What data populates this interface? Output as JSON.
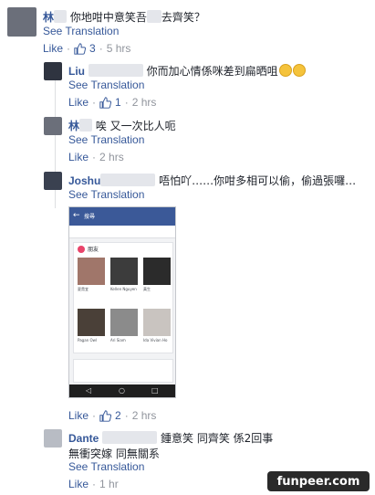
{
  "comments": [
    {
      "name": "林",
      "text_before": "你地咁中意笑吾",
      "text_after": "去齊笑？",
      "translation": "See Translation",
      "like": "Like",
      "likes": "3",
      "time": "5 hrs"
    },
    {
      "name": "Liu",
      "text": "你而加心情係咪差到扁晒咀",
      "translation": "See Translation",
      "like": "Like",
      "likes": "1",
      "time": "2 hrs"
    },
    {
      "name": "林",
      "text": "唉 又一次比人呃",
      "translation": "See Translation",
      "like": "Like",
      "time": "2 hrs"
    },
    {
      "name": "Joshu",
      "text": "唔怕吖……你咁多相可以偷，偷過張囉…",
      "translation": "See Translation",
      "like": "Like",
      "likes": "2",
      "time": "2 hrs"
    },
    {
      "name": "Dante",
      "text_line1": "鍾意笑 同齊笑 係2回事",
      "text_line2": "無衝突嫁 同無關系",
      "translation": "See Translation",
      "like": "Like",
      "time": "1 hr"
    }
  ],
  "screenshot": {
    "search_label": "搜尋",
    "section_title": "朋友",
    "friends": [
      "夏貴宜",
      "Kellen Nguyen",
      "黃生",
      "Pagan Owl",
      "Ari Siam",
      "Ida Vivian Ho"
    ]
  },
  "watermark": "funpeer.com",
  "colors": {
    "link": "#365899",
    "meta": "#90949c",
    "fb_blue": "#3b5998"
  }
}
